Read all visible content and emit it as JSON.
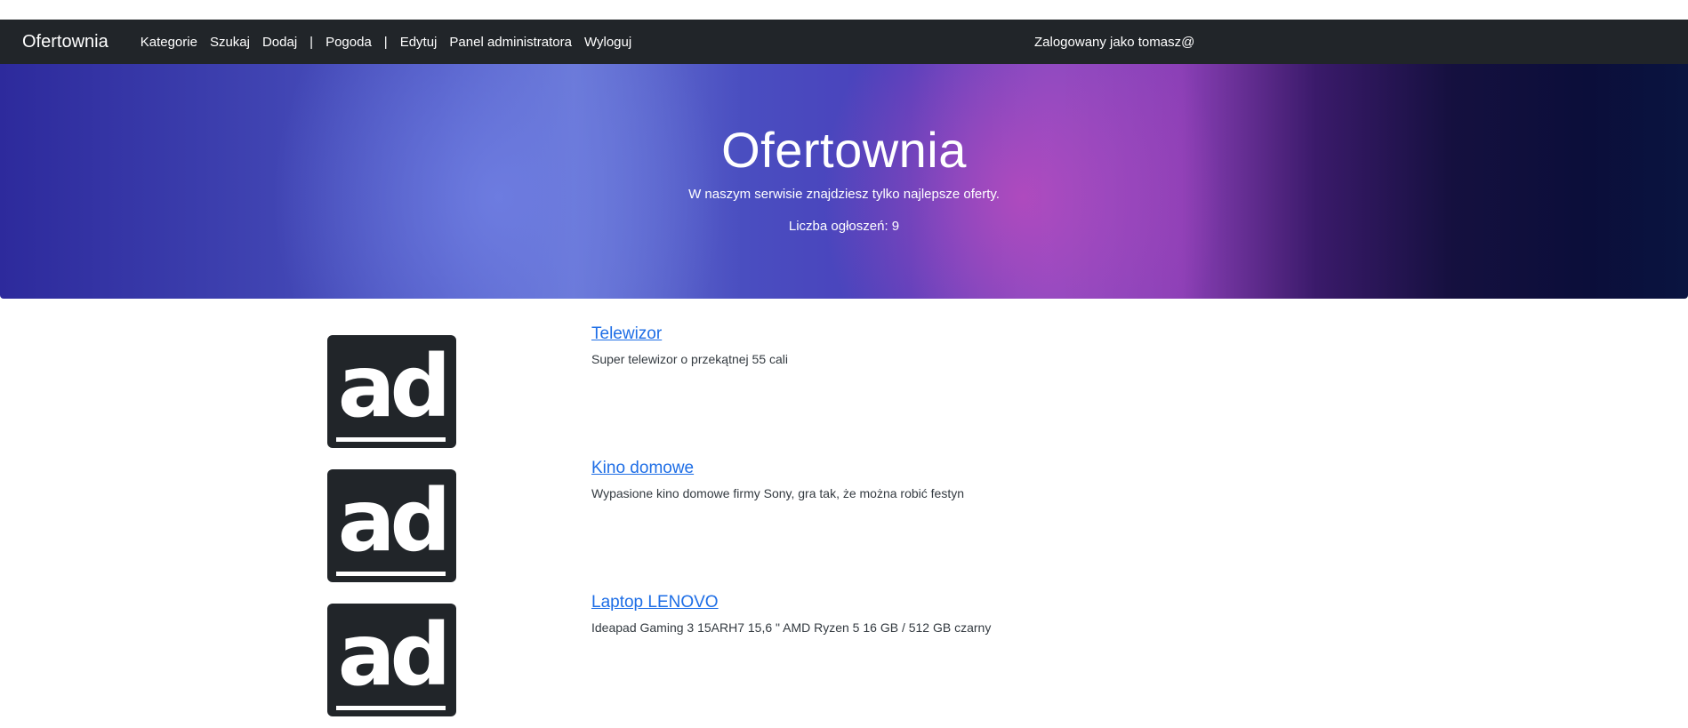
{
  "navbar": {
    "brand": "Ofertownia",
    "links": [
      "Kategorie",
      "Szukaj",
      "Dodaj",
      "Pogoda",
      "Edytuj",
      "Panel administratora",
      "Wyloguj"
    ],
    "separator": "|",
    "user": "Zalogowany jako tomasz@"
  },
  "hero": {
    "title": "Ofertownia",
    "subtitle": "W naszym serwisie znajdziesz tylko najlepsze oferty.",
    "count": "Liczba ogłoszeń: 9"
  },
  "listings": [
    {
      "thumb": "ad",
      "title": "Telewizor",
      "desc": "Super telewizor o przekątnej 55 cali"
    },
    {
      "thumb": "ad",
      "title": "Kino domowe",
      "desc": "Wypasione kino domowe firmy Sony, gra tak, że można robić festyn"
    },
    {
      "thumb": "ad",
      "title": "Laptop LENOVO",
      "desc": "Ideapad Gaming 3 15ARH7 15,6 \" AMD Ryzen 5 16 GB / 512 GB czarny"
    }
  ]
}
